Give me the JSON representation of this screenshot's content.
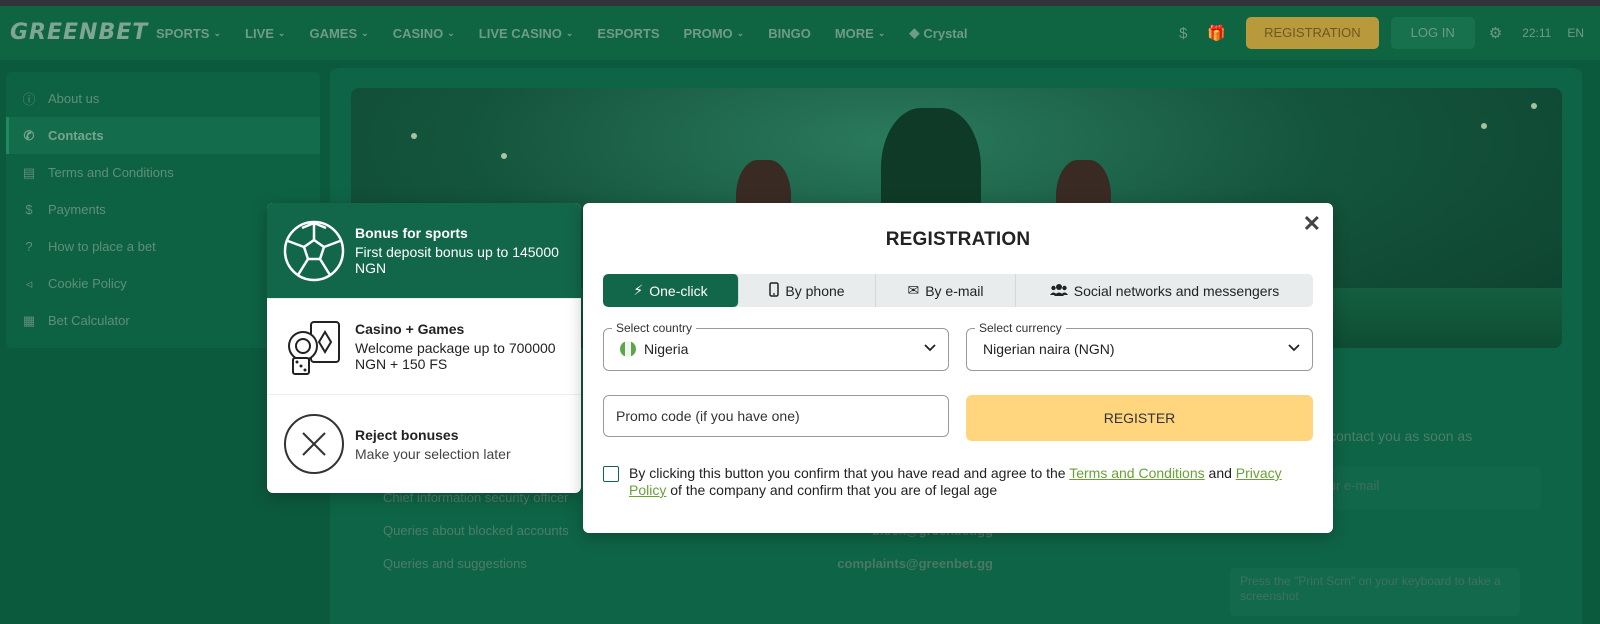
{
  "header": {
    "logo": "GREENBET",
    "nav": [
      "SPORTS",
      "LIVE",
      "GAMES",
      "CASINO",
      "LIVE CASINO",
      "ESPORTS",
      "PROMO",
      "BINGO",
      "MORE",
      "Crystal"
    ],
    "registration_label": "REGISTRATION",
    "login_label": "LOG IN",
    "time": "22:11",
    "language": "EN"
  },
  "sidebar": {
    "items": [
      {
        "label": "About us"
      },
      {
        "label": "Contacts"
      },
      {
        "label": "Terms and Conditions"
      },
      {
        "label": "Payments"
      },
      {
        "label": "How to place a bet"
      },
      {
        "label": "Cookie Policy"
      },
      {
        "label": "Bet Calculator"
      }
    ]
  },
  "contacts": {
    "rows": [
      {
        "label": "Chief information security officer",
        "email": ""
      },
      {
        "label": "Queries about blocked accounts",
        "email": "block@greenbet.gg"
      },
      {
        "label": "Queries and suggestions",
        "email": "complaints@greenbet.gg"
      }
    ],
    "form_text": "contact you as soon as",
    "email_placeholder": "your e-mail",
    "hint": "Press the \"Print Scrn\" on your keyboard to take a screenshot"
  },
  "bonus": {
    "options": [
      {
        "title": "Bonus for sports",
        "desc": "First deposit bonus up to 145000 NGN",
        "icon": "soccer-ball-icon"
      },
      {
        "title": "Casino + Games",
        "desc": "Welcome package up to 700000 NGN + 150 FS",
        "icon": "casino-chips-cards-icon"
      },
      {
        "title": "Reject bonuses",
        "desc": "Make your selection later",
        "icon": "reject-x-icon"
      }
    ]
  },
  "modal": {
    "title": "REGISTRATION",
    "close": "✕",
    "tabs": [
      {
        "label": "One-click",
        "icon": "lightning-icon"
      },
      {
        "label": "By phone",
        "icon": "phone-icon"
      },
      {
        "label": "By e-mail",
        "icon": "envelope-icon"
      },
      {
        "label": "Social networks and messengers",
        "icon": "users-icon"
      }
    ],
    "country": {
      "legend": "Select country",
      "value": "Nigeria"
    },
    "currency": {
      "legend": "Select currency",
      "value": "Nigerian naira (NGN)"
    },
    "promo_placeholder": "Promo code (if you have one)",
    "register_label": "REGISTER",
    "agree": {
      "prefix": "By clicking this button you confirm that you have read and agree to the ",
      "terms_link": "Terms and Conditions",
      "middle": " and ",
      "privacy_link": "Privacy Policy",
      "suffix": " of the company and confirm that you are of legal age"
    }
  },
  "colors": {
    "brand_green": "#12664a",
    "register_yellow": "#ffd67e",
    "link_green": "#6aa037"
  }
}
